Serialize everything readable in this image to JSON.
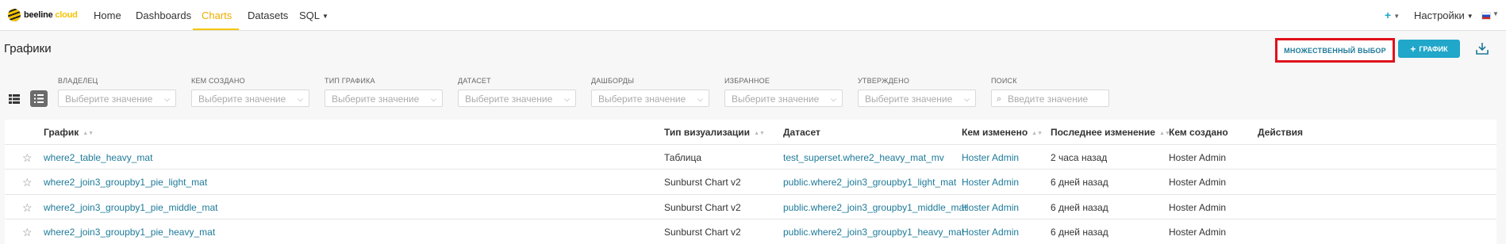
{
  "nav": {
    "logo_main": "beeline",
    "logo_accent": "cloud",
    "items": [
      {
        "label": "Home"
      },
      {
        "label": "Dashboards"
      },
      {
        "label": "Charts"
      },
      {
        "label": "Datasets"
      },
      {
        "label": "SQL"
      }
    ],
    "active": "Charts",
    "plus_label": "+",
    "settings_label": "Настройки",
    "language_flag": "ru"
  },
  "header": {
    "title": "Графики",
    "multi_select_label": "МНОЖЕСТВЕННЫЙ ВЫБОР",
    "new_chart_label": "ГРАФИК",
    "download_icon": "download-icon"
  },
  "filters": [
    {
      "label": "ВЛАДЕЛЕЦ",
      "placeholder": "Выберите значение"
    },
    {
      "label": "КЕМ СОЗДАНО",
      "placeholder": "Выберите значение"
    },
    {
      "label": "ТИП ГРАФИКА",
      "placeholder": "Выберите значение"
    },
    {
      "label": "ДАТАСЕТ",
      "placeholder": "Выберите значение"
    },
    {
      "label": "ДАШБОРДЫ",
      "placeholder": "Выберите значение"
    },
    {
      "label": "ИЗБРАННОЕ",
      "placeholder": "Выберите значение"
    },
    {
      "label": "УТВЕРЖДЕНО",
      "placeholder": "Выберите значение"
    },
    {
      "label": "ПОИСК",
      "placeholder": "Введите значение"
    }
  ],
  "table": {
    "columns": [
      "График",
      "Тип визуализации",
      "Датасет",
      "Кем изменено",
      "Последнее изменение",
      "Кем создано",
      "Действия"
    ],
    "rows": [
      {
        "name": "where2_table_heavy_mat",
        "viz": "Таблица",
        "dataset": "test_superset.where2_heavy_mat_mv",
        "modified_by": "Hoster Admin",
        "modified": "2 часа назад",
        "created_by": "Hoster Admin"
      },
      {
        "name": "where2_join3_groupby1_pie_light_mat",
        "viz": "Sunburst Chart v2",
        "dataset": "public.where2_join3_groupby1_light_mat",
        "modified_by": "Hoster Admin",
        "modified": "6 дней назад",
        "created_by": "Hoster Admin"
      },
      {
        "name": "where2_join3_groupby1_pie_middle_mat",
        "viz": "Sunburst Chart v2",
        "dataset": "public.where2_join3_groupby1_middle_mat",
        "modified_by": "Hoster Admin",
        "modified": "6 дней назад",
        "created_by": "Hoster Admin"
      },
      {
        "name": "where2_join3_groupby1_pie_heavy_mat",
        "viz": "Sunburst Chart v2",
        "dataset": "public.where2_join3_groupby1_heavy_mat",
        "modified_by": "Hoster Admin",
        "modified": "6 дней назад",
        "created_by": "Hoster Admin"
      }
    ]
  },
  "colors": {
    "accent": "#20a7c9",
    "link": "#1d7a99",
    "brand_yellow": "#f5c400",
    "highlight_red": "#e0101a"
  }
}
